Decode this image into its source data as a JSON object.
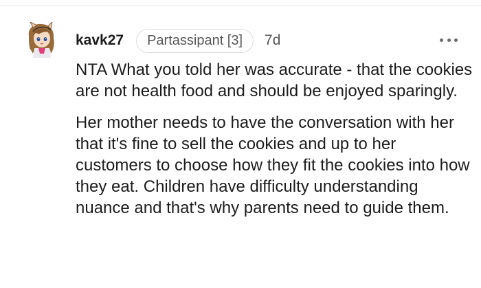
{
  "comment": {
    "username": "kavk27",
    "flair": "Partassipant [3]",
    "timestamp": "7d",
    "more_icon": "more-horizontal-icon",
    "paragraphs": [
      "NTA What you told her was accurate - that the cookies are not health food and should be enjoyed sparingly.",
      "Her mother needs to have the conversation with her that it's fine to sell the cookies and up to her customers to choose how they fit the cookies into how they eat. Children have difficulty understanding nuance and that's why parents need to guide them."
    ]
  }
}
